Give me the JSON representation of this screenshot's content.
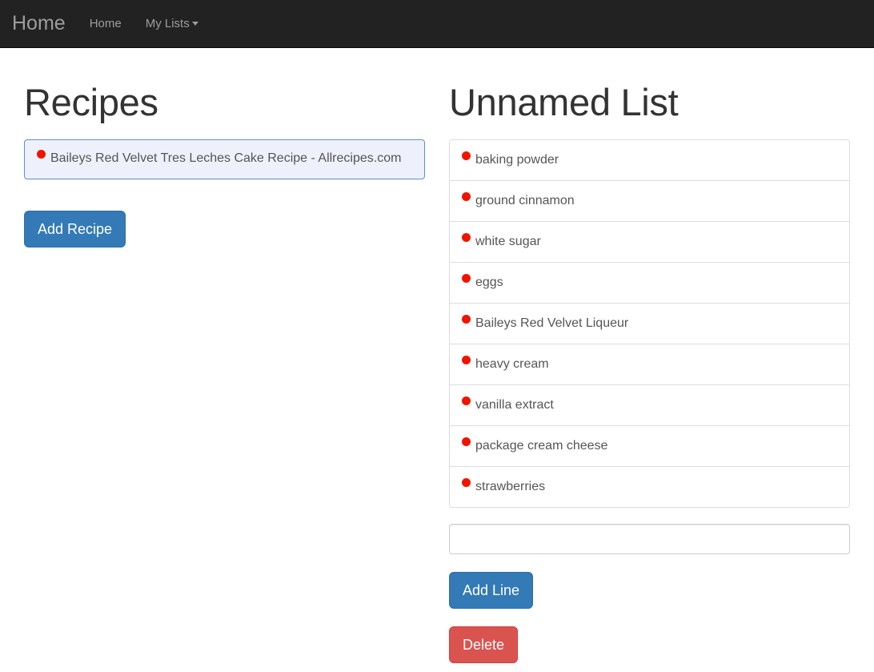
{
  "navbar": {
    "brand": "Home",
    "items": [
      {
        "label": "Home",
        "has_caret": false
      },
      {
        "label": "My Lists",
        "has_caret": true
      }
    ],
    "background_color": "#222222",
    "link_color": "#9d9d9d"
  },
  "recipes_panel": {
    "heading": "Recipes",
    "items": [
      {
        "bullet_color": "#f01400",
        "text": "Baileys Red Velvet Tres Leches Cake Recipe - Allrecipes.com"
      }
    ],
    "add_button_label": "Add Recipe",
    "add_button_color": "#337ab7"
  },
  "list_panel": {
    "heading": "Unnamed List",
    "items": [
      {
        "bullet_color": "#f01400",
        "text": "baking powder"
      },
      {
        "bullet_color": "#f01400",
        "text": "ground cinnamon"
      },
      {
        "bullet_color": "#f01400",
        "text": "white sugar"
      },
      {
        "bullet_color": "#f01400",
        "text": "eggs"
      },
      {
        "bullet_color": "#f01400",
        "text": "Baileys Red Velvet Liqueur"
      },
      {
        "bullet_color": "#f01400",
        "text": "heavy cream"
      },
      {
        "bullet_color": "#f01400",
        "text": "vanilla extract"
      },
      {
        "bullet_color": "#f01400",
        "text": "package cream cheese"
      },
      {
        "bullet_color": "#f01400",
        "text": "strawberries"
      }
    ],
    "new_line_input": {
      "value": "",
      "placeholder": ""
    },
    "add_line_button_label": "Add Line",
    "add_line_button_color": "#337ab7",
    "delete_button_label": "Delete",
    "delete_button_color": "#d9534f"
  }
}
